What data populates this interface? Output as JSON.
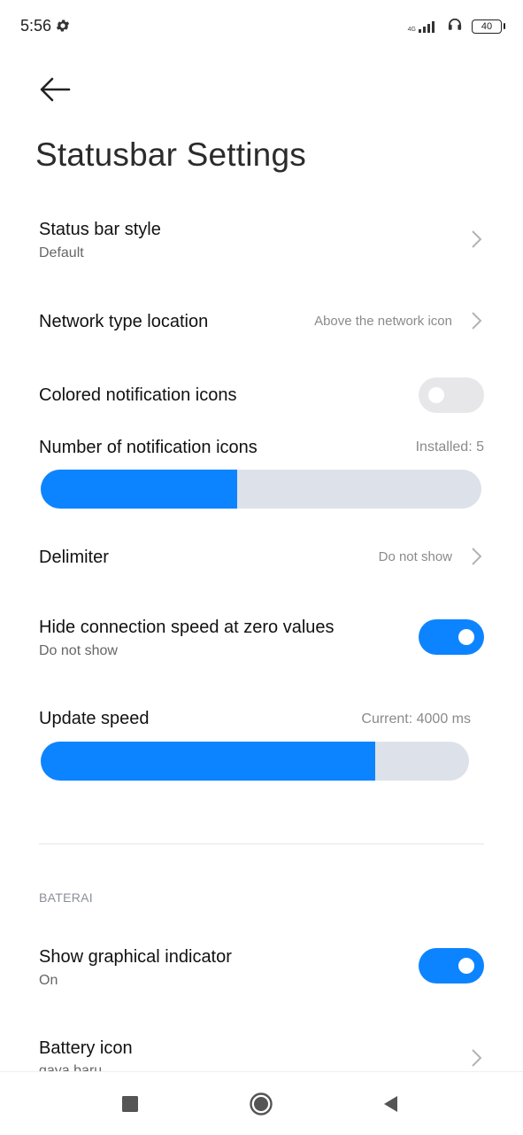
{
  "status_bar": {
    "time": "5:56",
    "network_label": "4G",
    "battery": "40",
    "icons": [
      "gear-icon",
      "signal-icon",
      "headphones-icon",
      "battery-icon"
    ]
  },
  "header": {
    "back_icon": "arrow-left-icon",
    "title": "Statusbar Settings"
  },
  "settings": {
    "status_bar_style": {
      "title": "Status bar style",
      "subtitle": "Default"
    },
    "network_type_location": {
      "title": "Network type location",
      "value": "Above the network icon"
    },
    "colored_notification_icons": {
      "title": "Colored notification icons",
      "enabled": false
    },
    "number_of_notification_icons": {
      "title": "Number of notification icons",
      "value": "Installed: 5",
      "fill": 0.445
    },
    "delimiter": {
      "title": "Delimiter",
      "value": "Do not show"
    },
    "hide_connection_speed": {
      "title": "Hide connection speed at zero values",
      "subtitle": "Do not show",
      "enabled": true
    },
    "update_speed": {
      "title": "Update speed",
      "value": "Current: 4000 ms",
      "fill": 0.78
    }
  },
  "battery_section": {
    "header": "BATERAI",
    "show_graphical_indicator": {
      "title": "Show graphical indicator",
      "subtitle": "On",
      "enabled": true
    },
    "battery_icon": {
      "title": "Battery icon",
      "subtitle": "gaya baru"
    }
  },
  "colors": {
    "accent": "#0d84ff",
    "toggle_off": "#e7e7ea",
    "slider_track": "#dde2ea"
  },
  "nav_bar": {
    "icons": [
      "square-icon",
      "circle-icon",
      "triangle-back-icon"
    ]
  }
}
